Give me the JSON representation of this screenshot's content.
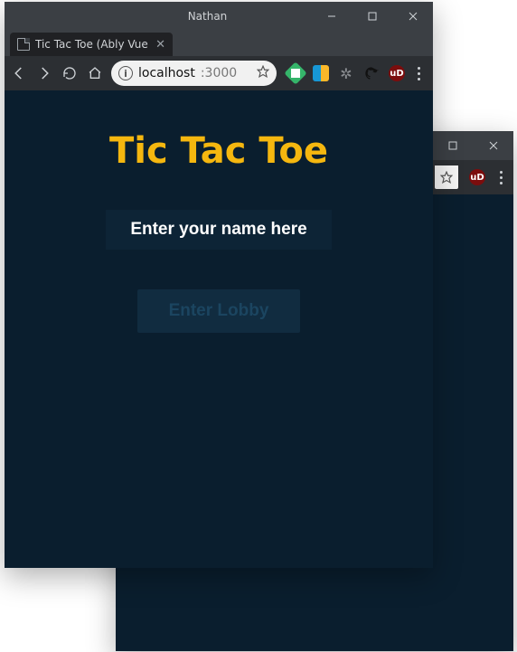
{
  "windowTitle": "Nathan",
  "tab": {
    "label": "Tic Tac Toe (Ably Vue Tut"
  },
  "omnibox": {
    "host": "localhost",
    "rest": ":3000"
  },
  "page": {
    "heading": "Tic Tac Toe",
    "namePlaceholder": "Enter your name here",
    "enterButton": "Enter Lobby"
  },
  "icons": {
    "info": "i",
    "ublock": "uD"
  }
}
